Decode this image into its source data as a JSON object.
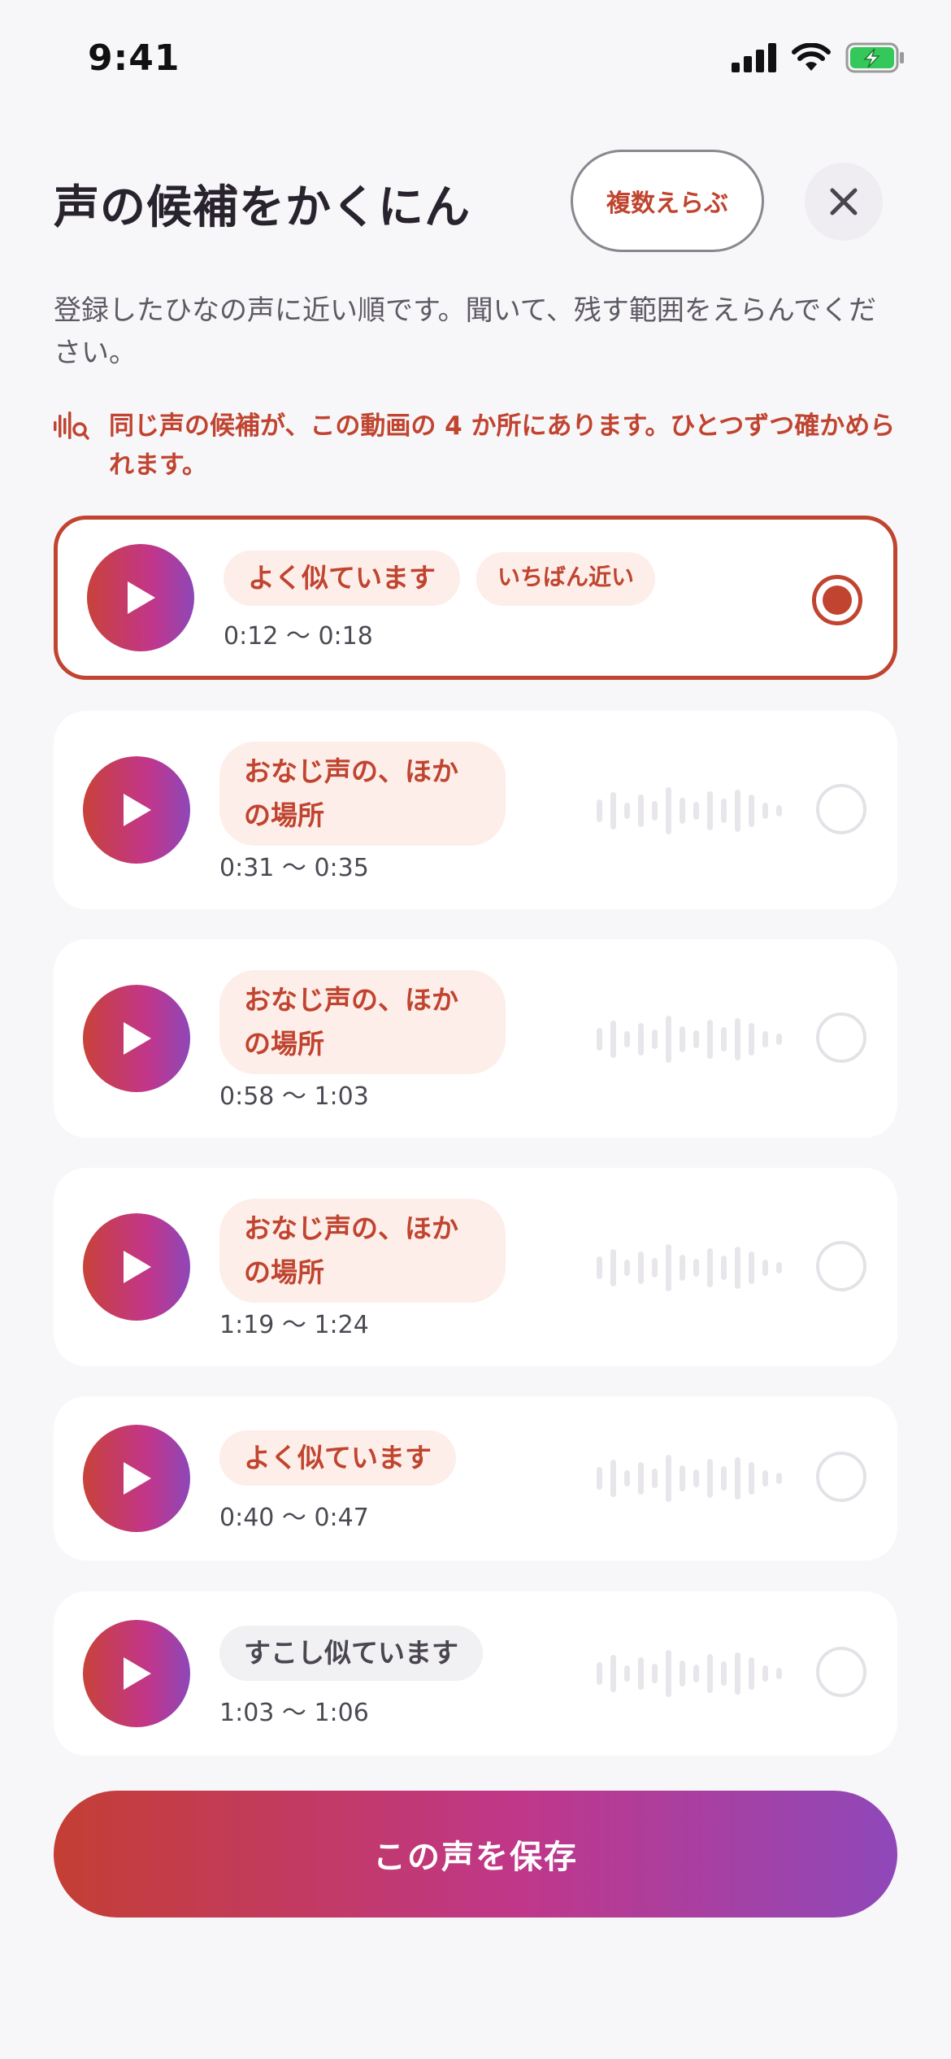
{
  "status": {
    "time": "9:41"
  },
  "header": {
    "title": "声の候補をかくにん",
    "multi_select_label": "複数えらぶ"
  },
  "description": "登録したひなの声に近い順です。聞いて、残す範囲をえらんでください。",
  "notice": "同じ声の候補が、この動画の 4 か所にあります。ひとつずつ確かめられます。",
  "candidates": [
    {
      "tag": "よく似ています",
      "tag2": "いちばん近い",
      "range": "0:12 〜 0:18",
      "selected": true
    },
    {
      "tag": "おなじ声の、ほかの場所",
      "range": "0:31 〜 0:35",
      "selected": false
    },
    {
      "tag": "おなじ声の、ほかの場所",
      "range": "0:58 〜 1:03",
      "selected": false
    },
    {
      "tag": "おなじ声の、ほかの場所",
      "range": "1:19 〜 1:24",
      "selected": false
    },
    {
      "tag": "よく似ています",
      "range": "0:40 〜 0:47",
      "selected": false
    },
    {
      "tag": "すこし似ています",
      "range": "1:03 〜 1:06",
      "selected": false
    }
  ],
  "save_label": "この声を保存",
  "colors": {
    "accent": "#c0442f",
    "gradient_start": "#c43e34",
    "gradient_mid": "#c0378a",
    "gradient_end": "#8f48b9"
  }
}
